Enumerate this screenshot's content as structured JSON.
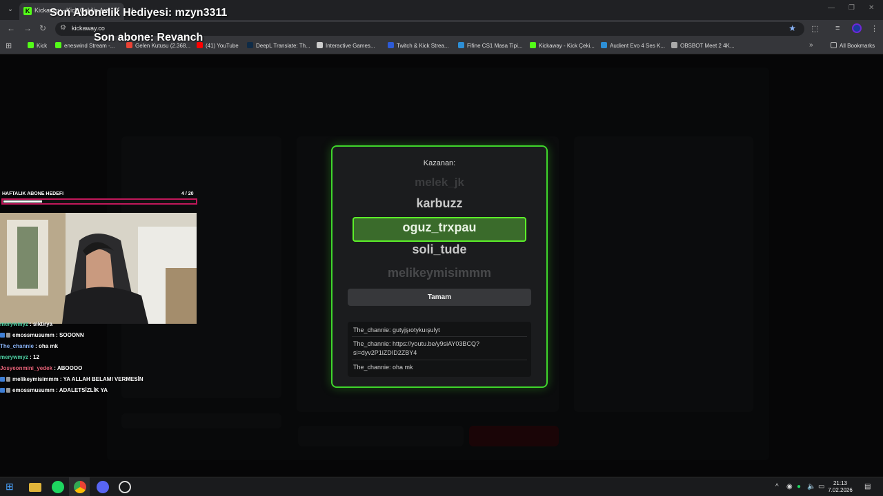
{
  "browser": {
    "tab_title": "Kickaway - Kick Çekiliş Aracı",
    "url": "kickaway.co",
    "bookmarks": [
      {
        "label": "Kick",
        "color": "#53fc18"
      },
      {
        "label": "eneswind Stream -...",
        "color": "#53fc18"
      },
      {
        "label": "Gelen Kutusu (2.368...",
        "color": "#ea4335"
      },
      {
        "label": "(41) YouTube",
        "color": "#ff0000"
      },
      {
        "label": "DeepL Translate: Th...",
        "color": "#0f2b46"
      },
      {
        "label": "Interactive Games...",
        "color": "#cccccc"
      },
      {
        "label": "Twitch & Kick Strea...",
        "color": "#2d5bd6"
      },
      {
        "label": "Fifine CS1 Masa Tipi...",
        "color": "#2d8fd6"
      },
      {
        "label": "Kickaway - Kick Çeki...",
        "color": "#53fc18"
      },
      {
        "label": "Audient Evo 4 Ses K...",
        "color": "#2d8fd6"
      },
      {
        "label": "OBSBOT Meet 2 4K...",
        "color": "#aaaaaa"
      }
    ],
    "all_bookmarks_label": "All Bookmarks"
  },
  "overlay": {
    "last_gift": "Son Abonelik Hediyesi: mzyn3311",
    "last_sub": "Son abone: Revanch",
    "goal_label": "HAFTALIK ABONE HEDEFI",
    "goal_count": "4  / 20",
    "goal_progress": 0.2
  },
  "modal": {
    "label": "Kazanan:",
    "names": [
      "melek_jk",
      "karbuzz",
      "oguz_trxpau",
      "soli_tude",
      "melikeymisimmm"
    ],
    "winner": "oguz_trxpau",
    "ok_label": "Tamam",
    "messages": [
      "The_channie: gutyjşıotykuışulyt",
      "The_channie: https://youtu.be/y9siAY03BCQ?si=dyv2P1iZDID2ZBY4",
      "The_channie: oha mk"
    ],
    "accent": "#53fc18"
  },
  "chat": [
    {
      "user": "merywmyz",
      "text": " : siktirya",
      "color": "#4fd1a5",
      "badges": 0
    },
    {
      "user": "emossmusumm",
      "text": " : SOOONN",
      "color": "#ffffff",
      "badges": 2
    },
    {
      "user": "The_channie",
      "text": " : oha mk",
      "color": "#8ab4f8",
      "badges": 0
    },
    {
      "user": "merywmyz",
      "text": " : 12",
      "color": "#4fd1a5",
      "badges": 0
    },
    {
      "user": "Josyeonmini_yedek",
      "text": " : ABOOOO",
      "color": "#e8647a",
      "badges": 0
    },
    {
      "user": "melikeymisimmm",
      "text": " : YA ALLAH BELAMI VERMESİN",
      "color": "#ffffff",
      "badges": 2
    },
    {
      "user": "emossmusumm",
      "text": " : ADALETSİZLİK YA",
      "color": "#ffffff",
      "badges": 2
    }
  ],
  "taskbar": {
    "time": "21:13",
    "date": "7.02.2026"
  }
}
